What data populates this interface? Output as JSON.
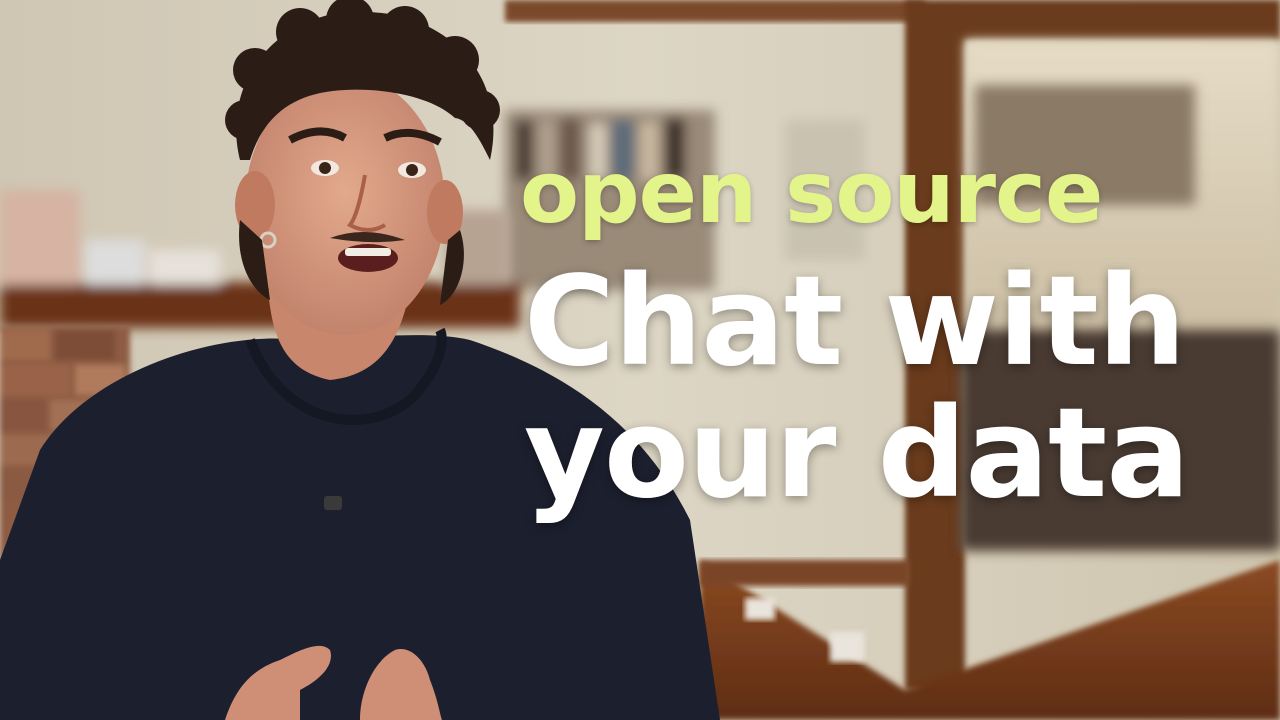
{
  "thumbnail": {
    "headline": {
      "accent_line": "open source",
      "main_line_1": "Chat with",
      "main_line_2": "your data"
    },
    "colors": {
      "accent": "#e3f58a",
      "main_text": "#ffffff",
      "shirt": "#1c1f2e",
      "wall": "#d8d0bd",
      "wood_trim": "#6b3a1e",
      "floor": "#7a3f1f"
    }
  }
}
